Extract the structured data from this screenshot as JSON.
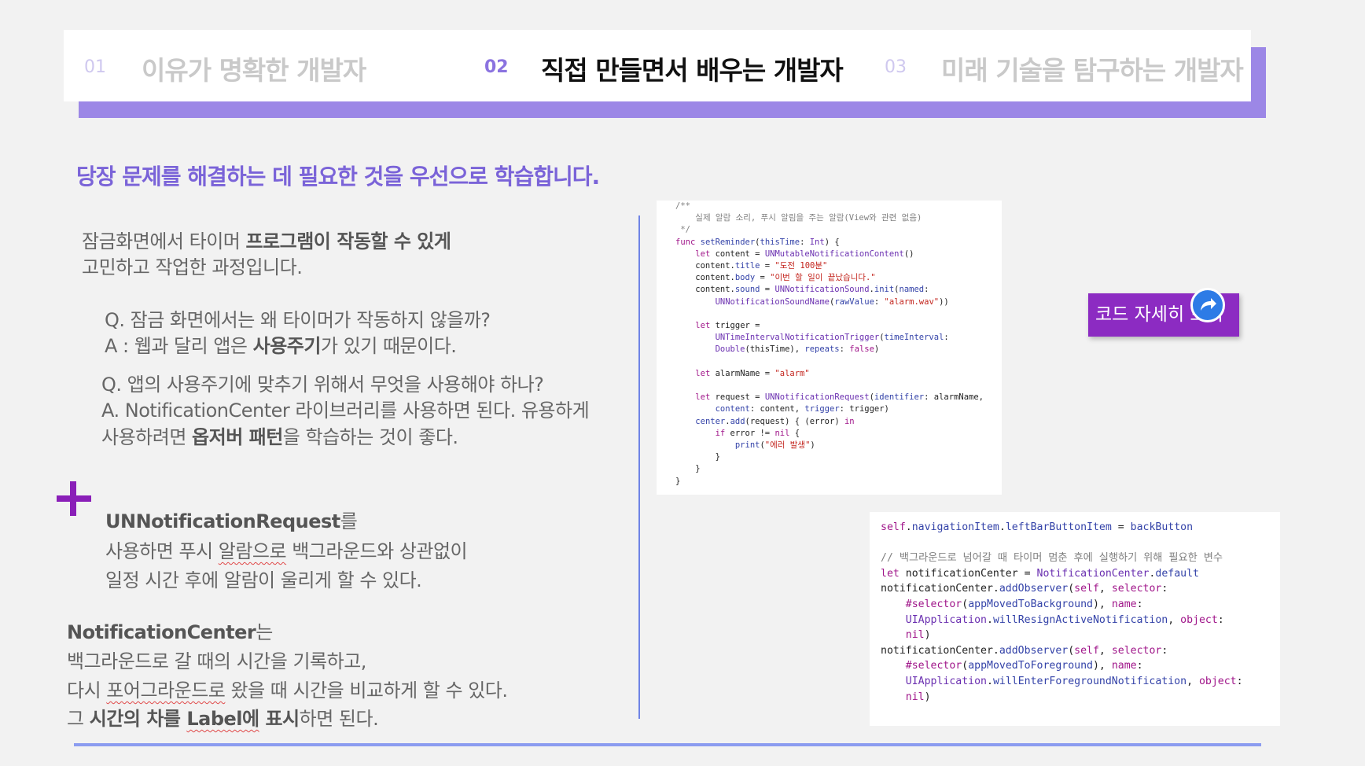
{
  "tabs": [
    {
      "num": "01",
      "label": "이유가 명확한 개발자"
    },
    {
      "num": "02",
      "label": "직접 만들면서 배우는 개발자"
    },
    {
      "num": "03",
      "label": "미래 기술을 탐구하는 개발자"
    }
  ],
  "headline": "당장 문제를 해결하는 데 필요한 것을 우선으로 학습합니다.",
  "intro": {
    "l1_pre": "잠금화면에서 타이머 ",
    "l1_bold": "프로그램이 작동할 수 있게",
    "l2": "고민하고 작업한 과정입니다."
  },
  "qa1": {
    "q": "Q. 잠금 화면에서는 왜 타이머가 작동하지 않을까?",
    "a_pre": "A : 웹과 달리 앱은 ",
    "a_bold": "사용주기",
    "a_post": "가 있기 때문이다."
  },
  "qa2": {
    "q": "Q. 앱의 사용주기에 맞추기 위해서 무엇을 사용해야 하나?",
    "a1": "A. NotificationCenter 라이브러리를 사용하면 된다. 유용하게",
    "a2_pre": "사용하려면 ",
    "a2_bold": "옵저버 패턴",
    "a2_post": "을 학습하는 것이 좋다."
  },
  "note1": {
    "l1_bold": "UNNotificationRequest",
    "l1_post": "를",
    "l2_pre": "사용하면 푸시 ",
    "l2_wavy": "알람으로",
    "l2_post": " 백그라운드와 상관없이",
    "l3": "일정 시간 후에 알람이 울리게 할 수 있다."
  },
  "note2": {
    "l1_bold": "NotificationCenter",
    "l1_post": "는",
    "l2": "백그라운드로 갈 때의 시간을 기록하고,",
    "l3_pre": "다시 ",
    "l3_wavy": "포어그라운드로",
    "l3_post": " 왔을 때 시간을 비교하게 할 수 있다.",
    "l4_pre": "그 ",
    "l4_bold1": "시간의 차를 ",
    "l4_wavy": "Label에",
    "l4_bold2": " 표시",
    "l4_post": "하면 된다."
  },
  "code_button": {
    "label": "코드 자세히 보기",
    "icon": "share-arrow-icon"
  },
  "code_snippet_1": [
    "/**",
    "    실제 알람 소리, 푸시 알림을 주는 알람(View와 관련 없음)",
    " */",
    "func setReminder(thisTime: Int) {",
    "    let content = UNMutableNotificationContent()",
    "    content.title = \"도전 100분\"",
    "    content.body = \"이번 할 일이 끝났습니다.\"",
    "    content.sound = UNNotificationSound.init(named:",
    "        UNNotificationSoundName(rawValue: \"alarm.wav\"))",
    "",
    "    let trigger =",
    "        UNTimeIntervalNotificationTrigger(timeInterval:",
    "        Double(thisTime), repeats: false)",
    "",
    "    let alarmName = \"alarm\"",
    "",
    "    let request = UNNotificationRequest(identifier: alarmName,",
    "        content: content, trigger: trigger)",
    "    center.add(request) { (error) in",
    "        if error != nil {",
    "            print(\"에러 발생\")",
    "        }",
    "    }",
    "}"
  ],
  "code_snippet_2": [
    "self.navigationItem.leftBarButtonItem = backButton",
    "",
    "// 백그라운드로 넘어갈 때 타이머 멈춘 후에 실행하기 위해 필요한 변수",
    "let notificationCenter = NotificationCenter.default",
    "notificationCenter.addObserver(self, selector:",
    "    #selector(appMovedToBackground), name:",
    "    UIApplication.willResignActiveNotification, object:",
    "    nil)",
    "notificationCenter.addObserver(self, selector:",
    "    #selector(appMovedToForeground), name:",
    "    UIApplication.willEnterForegroundNotification, object:",
    "    nil)"
  ],
  "colors": {
    "accent": "#7a63d8",
    "tab_shadow": "#9c87e6",
    "button": "#8c2bc2",
    "plus": "#8a1fb8",
    "divider": "#6f84e6",
    "share_icon": "#2d7be6"
  }
}
